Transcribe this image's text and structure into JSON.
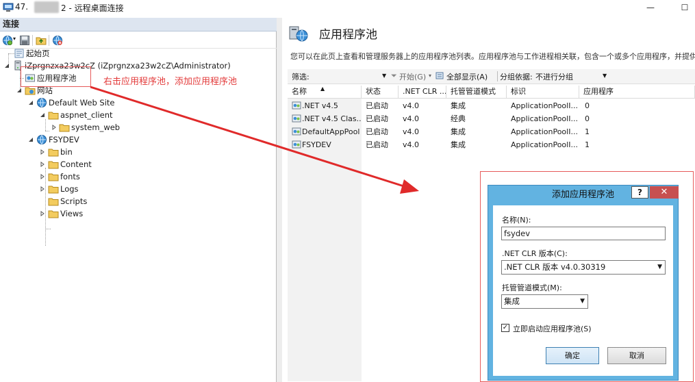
{
  "window": {
    "title_prefix": "47.",
    "title_suffix": "2 - 远程桌面连接",
    "minimize_glyph": "—",
    "restore_glyph": "☐"
  },
  "connections": {
    "header": "连接",
    "tree": {
      "start_page": "起始页",
      "server": "iZprgnzxa23w2cZ (iZprgnzxa23w2cZ\\Administrator)",
      "app_pools": "应用程序池",
      "sites": "网站",
      "default_site": "Default Web Site",
      "aspnet_client": "aspnet_client",
      "system_web": "system_web",
      "fsydev": "FSYDEV",
      "children": [
        "bin",
        "Content",
        "fonts",
        "Logs",
        "Scripts",
        "Views"
      ]
    }
  },
  "annotation": {
    "text": "右击应用程序池，添加应用程序池",
    "color": "#e33b3b"
  },
  "main": {
    "title": "应用程序池",
    "description": "您可以在此页上查看和管理服务器上的应用程序池列表。应用程序池与工作进程相关联，包含一个或多个应用程序，并提供不同",
    "filter_label": "筛选:",
    "start_label": "开始(G)",
    "show_all_label": "全部显示(A)",
    "group_by_label": "分组依据:",
    "group_by_value": "不进行分组",
    "columns": [
      "名称",
      "状态",
      ".NET CLR ...",
      "托管管道模式",
      "标识",
      "应用程序"
    ],
    "rows": [
      {
        "name": ".NET v4.5",
        "status": "已启动",
        "clr": "v4.0",
        "pipeline": "集成",
        "identity": "ApplicationPoolI...",
        "apps": "0"
      },
      {
        "name": ".NET v4.5 Clas...",
        "status": "已启动",
        "clr": "v4.0",
        "pipeline": "经典",
        "identity": "ApplicationPoolI...",
        "apps": "0"
      },
      {
        "name": "DefaultAppPool",
        "status": "已启动",
        "clr": "v4.0",
        "pipeline": "集成",
        "identity": "ApplicationPoolI...",
        "apps": "1"
      },
      {
        "name": "FSYDEV",
        "status": "已启动",
        "clr": "v4.0",
        "pipeline": "集成",
        "identity": "ApplicationPoolI...",
        "apps": "1"
      }
    ]
  },
  "dialog": {
    "title": "添加应用程序池",
    "help_glyph": "?",
    "close_glyph": "✕",
    "name_label": "名称(N):",
    "name_value": "fsydev",
    "clr_label": ".NET CLR 版本(C):",
    "clr_value": ".NET CLR 版本 v4.0.30319",
    "pipeline_label": "托管管道模式(M):",
    "pipeline_value": "集成",
    "start_checkbox_label": "立即启动应用程序池(S)",
    "start_checked": true,
    "ok_label": "确定",
    "cancel_label": "取消"
  },
  "colors": {
    "dialog_frame": "#62b3e1",
    "close_button": "#c75050",
    "pane_header": "#dde5f0"
  }
}
